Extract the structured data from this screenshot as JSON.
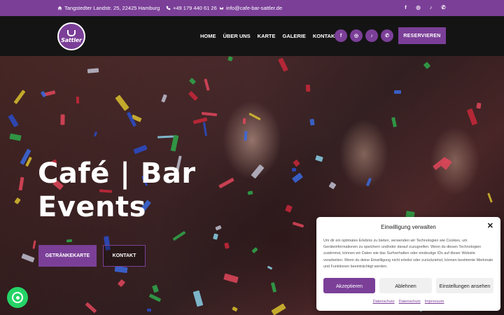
{
  "topbar": {
    "address": "Tangstedter Landstr. 25, 22425 Hamburg",
    "phone": "+49 179 440 61 26",
    "email": "info@cafe-bar-sattler.de",
    "socials": [
      "f",
      "◎",
      "♪",
      "✆"
    ]
  },
  "header": {
    "logo_text": "Sattler",
    "nav": [
      "HOME",
      "ÜBER UNS",
      "KARTE",
      "GALERIE",
      "KONTAKT"
    ],
    "socials": [
      "f",
      "◎",
      "♪",
      "✆"
    ],
    "reserve_label": "RESERVIEREN"
  },
  "hero": {
    "title_line1": "Café | Bar",
    "title_line2": "Events",
    "drinks_button": "GETRÄNKEKARTE",
    "contact_button": "KONTAKT"
  },
  "consent": {
    "title": "Einwilligung verwalten",
    "close": "✕",
    "text": "Um dir ein optimales Erlebnis zu bieten, verwenden wir Technologien wie Cookies, um Geräteinformationen zu speichern und/oder darauf zuzugreifen. Wenn du diesen Technologien zustimmst, können wir Daten wie das Surfverhalten oder eindeutige IDs auf dieser Website verarbeiten. Wenn du deine Einwilligung nicht erteilst oder zurückziehst, können bestimmte Merkmale und Funktionen beeinträchtigt werden.",
    "accept": "Akzeptieren",
    "deny": "Ablehnen",
    "preferences": "Einstellungen ansehen",
    "links": [
      "Datenschutz",
      "Datenschutz",
      "Impressum"
    ]
  },
  "colors": {
    "brand": "#7b3f98",
    "whatsapp": "#25d366"
  }
}
